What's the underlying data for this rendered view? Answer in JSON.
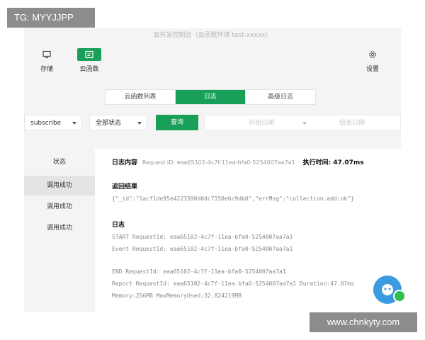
{
  "window": {
    "title": "云开发控制台（云函数环境 test-xxxxx）"
  },
  "toolbar": {
    "storage_label": "存储",
    "cloud_function_label": "云函数",
    "settings_label": "设置"
  },
  "tabs": [
    {
      "label": "云函数列表"
    },
    {
      "label": "日志"
    },
    {
      "label": "高级日志"
    }
  ],
  "filters": {
    "function_select": "subscribe",
    "status_select": "全部状态",
    "query_button": "查询",
    "start_date_placeholder": "开始日期",
    "end_date_placeholder": "结束日期"
  },
  "sidebar": {
    "header": "状态",
    "items": [
      {
        "label": "调用成功"
      },
      {
        "label": "调用成功"
      },
      {
        "label": "调用成功"
      }
    ]
  },
  "detail": {
    "log_content_label": "日志内容",
    "request_id_text": "Request ID: eaa65102-4c7f-11ea-bfa0-5254007aa7a1",
    "exec_time_label": "执行时间: 47.07ms",
    "return_label": "返回结果",
    "return_value": "{\"_id\":\"1acf1de95e4223590d0dc7150e6c9db0\",\"errMsg\":\"collection.add:ok\"}",
    "log_label": "日志",
    "log_lines": [
      "START RequestId: eaa65102-4c7f-11ea-bfa0-5254007aa7a1",
      "Event RequestId: eaa65102-4c7f-11ea-bfa0-5254007aa7a1",
      "END RequestId: eaa65102-4c7f-11ea-bfa0-5254007aa7a1",
      "Report RequestId: eaa65102-4c7f-11ea-bfa0-5254007aa7a1 Duration:47.07ms",
      "Memory:256MB MaxMemoryUsed:32.824219MB"
    ]
  },
  "watermarks": {
    "top_left": "TG: MYYJJPP",
    "bottom_right": "www.chnkyty.com"
  },
  "colors": {
    "accent": "#18a058",
    "float_button": "#3a9be0"
  }
}
